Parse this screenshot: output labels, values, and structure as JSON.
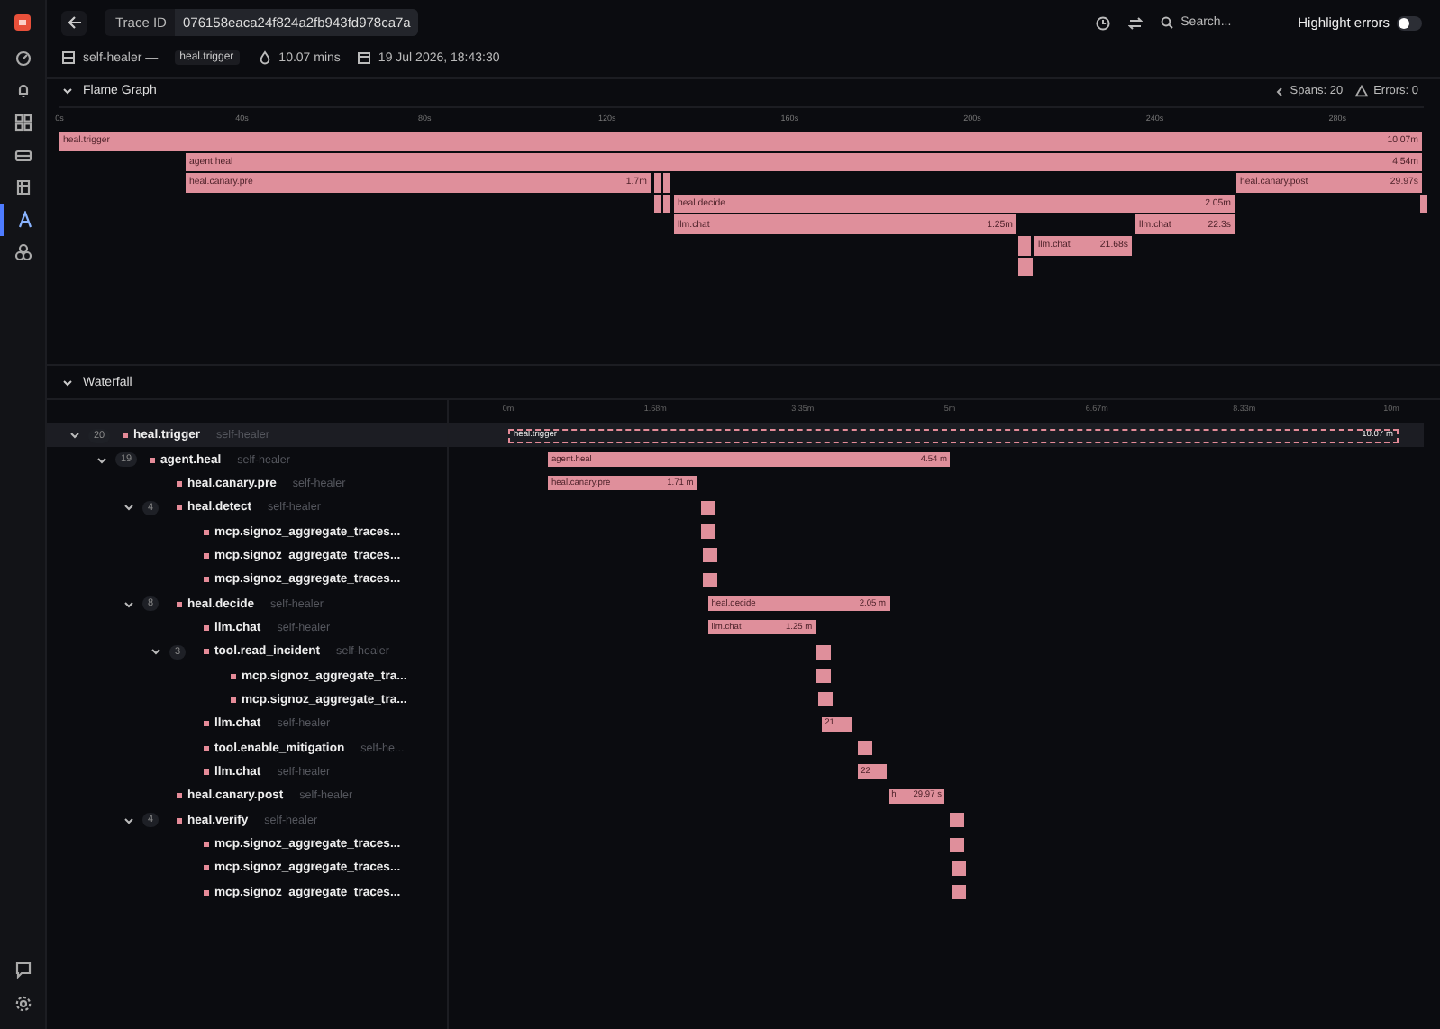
{
  "sidebar": {
    "items": [
      {
        "selected": false
      },
      {
        "selected": false
      },
      {
        "selected": false
      },
      {
        "selected": false
      },
      {
        "selected": false
      },
      {
        "selected": true
      },
      {
        "selected": false
      }
    ]
  },
  "header": {
    "trace_id_label": "Trace ID",
    "trace_id": "076158eaca24f824a2fb943fd978ca7a",
    "search": {
      "placeholder": "Search..."
    },
    "highlight_errors": {
      "label": "Highlight errors",
      "on": false
    }
  },
  "meta": {
    "service": "self-healer —",
    "root_span": "heal.trigger",
    "duration": "10.07 mins",
    "timestamp": "19 Jul 2026, 18:43:30"
  },
  "flame_graph": {
    "title": "Flame Graph",
    "expanded": true,
    "spans": "Spans: 20",
    "errors": "Errors: 0",
    "ticks": [
      "0s",
      "40s",
      "80s",
      "120s",
      "160s",
      "200s",
      "240s",
      "280s"
    ],
    "bars": [
      {
        "label": "heal.trigger",
        "duration": "10.07m"
      },
      {
        "label": "agent.heal",
        "duration": "4.54m"
      },
      {
        "label": "heal.canary.pre",
        "duration": "1.7m"
      },
      {
        "label": "heal.canary.post",
        "duration": "29.97s"
      },
      {
        "label": "heal.decide",
        "duration": "2.05m"
      },
      {
        "label": "llm.chat",
        "duration": "1.25m"
      },
      {
        "label": "llm.chat",
        "duration": "22.3s"
      },
      {
        "label": "llm.chat",
        "duration": "21.68s"
      }
    ]
  },
  "waterfall": {
    "title": "Waterfall",
    "expanded": true,
    "ticks": [
      "0m",
      "1.68m",
      "3.35m",
      "5m",
      "6.67m",
      "8.33m",
      "10m"
    ],
    "spans": [
      {
        "name": "heal.trigger",
        "service": "self-healer",
        "count": "20",
        "expanded": true,
        "selected": true,
        "bar": {
          "label": "heal.trigger",
          "duration": "10.07 m"
        },
        "children": [
          {
            "name": "agent.heal",
            "service": "self-healer",
            "count": "19",
            "expanded": true,
            "selected": false,
            "bar": {
              "label": "agent.heal",
              "duration": "4.54 m"
            },
            "children": [
              {
                "name": "heal.canary.pre",
                "service": "self-healer",
                "selected": false,
                "bar": {
                  "label": "heal.canary.pre",
                  "duration": "1.71 m"
                }
              },
              {
                "name": "heal.detect",
                "service": "self-healer",
                "count": "4",
                "expanded": true,
                "selected": false,
                "children": [
                  {
                    "name": "mcp.signoz_aggregate_traces...",
                    "selected": false
                  },
                  {
                    "name": "mcp.signoz_aggregate_traces...",
                    "selected": false
                  },
                  {
                    "name": "mcp.signoz_aggregate_traces...",
                    "selected": false
                  }
                ]
              },
              {
                "name": "heal.decide",
                "service": "self-healer",
                "count": "8",
                "expanded": true,
                "selected": false,
                "bar": {
                  "label": "heal.decide",
                  "duration": "2.05 m"
                },
                "children": [
                  {
                    "name": "llm.chat",
                    "service": "self-healer",
                    "selected": false,
                    "bar": {
                      "label": "llm.chat",
                      "duration": "1.25 m"
                    }
                  },
                  {
                    "name": "tool.read_incident",
                    "service": "self-healer",
                    "count": "3",
                    "expanded": true,
                    "selected": false,
                    "children": [
                      {
                        "name": "mcp.signoz_aggregate_tra...",
                        "selected": false
                      },
                      {
                        "name": "mcp.signoz_aggregate_tra...",
                        "selected": false
                      }
                    ]
                  },
                  {
                    "name": "llm.chat",
                    "service": "self-healer",
                    "selected": false,
                    "bar": {
                      "duration": "21"
                    }
                  },
                  {
                    "name": "tool.enable_mitigation",
                    "service": "self-he...",
                    "selected": false
                  },
                  {
                    "name": "llm.chat",
                    "service": "self-healer",
                    "selected": false,
                    "bar": {
                      "duration": "22"
                    }
                  }
                ]
              },
              {
                "name": "heal.canary.post",
                "service": "self-healer",
                "selected": false,
                "bar": {
                  "label": "h",
                  "duration": "29.97 s"
                }
              },
              {
                "name": "heal.verify",
                "service": "self-healer",
                "count": "4",
                "expanded": true,
                "selected": false,
                "children": [
                  {
                    "name": "mcp.signoz_aggregate_traces...",
                    "selected": false
                  },
                  {
                    "name": "mcp.signoz_aggregate_traces...",
                    "selected": false
                  },
                  {
                    "name": "mcp.signoz_aggregate_traces...",
                    "selected": false
                  }
                ]
              }
            ]
          }
        ]
      }
    ]
  }
}
